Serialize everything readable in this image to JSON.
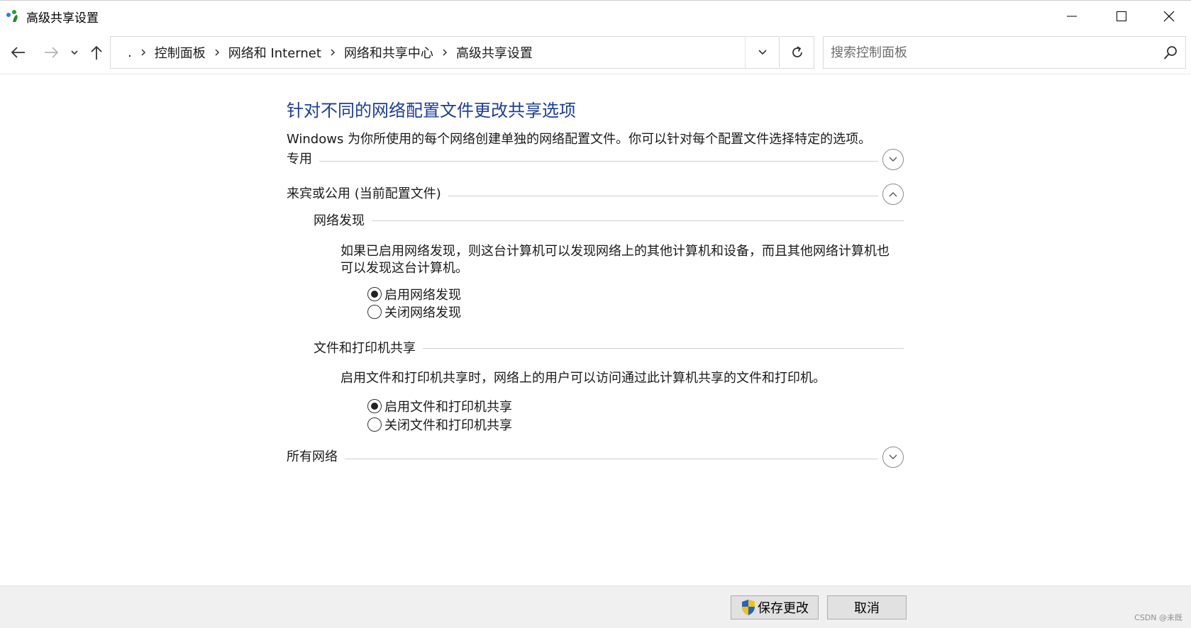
{
  "window": {
    "title": "高级共享设置"
  },
  "navigation": {
    "breadcrumb_root": ".",
    "breadcrumbs": [
      "控制面板",
      "网络和 Internet",
      "网络和共享中心",
      "高级共享设置"
    ],
    "search_placeholder": "搜索控制面板"
  },
  "main": {
    "title": "针对不同的网络配置文件更改共享选项",
    "description": "Windows 为你所使用的每个网络创建单独的网络配置文件。你可以针对每个配置文件选择特定的选项。",
    "sections": {
      "private": {
        "label": "专用",
        "expanded": false
      },
      "guest": {
        "label": "来宾或公用 (当前配置文件)",
        "expanded": true,
        "network_discovery": {
          "label": "网络发现",
          "description_line1": "如果已启用网络发现，则这台计算机可以发现网络上的其他计算机和设备，而且其他网络计算机也",
          "description_line2": "可以发现这台计算机。",
          "options": [
            "启用网络发现",
            "关闭网络发现"
          ],
          "selected": 0
        },
        "file_printer_sharing": {
          "label": "文件和打印机共享",
          "description": "启用文件和打印机共享时，网络上的用户可以访问通过此计算机共享的文件和打印机。",
          "options": [
            "启用文件和打印机共享",
            "关闭文件和打印机共享"
          ],
          "selected": 0
        }
      },
      "all_networks": {
        "label": "所有网络",
        "expanded": false
      }
    }
  },
  "footer": {
    "save_label": "保存更改",
    "cancel_label": "取消",
    "watermark": "CSDN @未既"
  },
  "colors": {
    "title_blue": "#1c3f94",
    "footer_bg": "#f0f0f0",
    "button_bg": "#e1e1e1"
  },
  "icons": [
    "network-app-icon",
    "minimize-icon",
    "maximize-icon",
    "close-icon",
    "back-arrow-icon",
    "forward-arrow-icon",
    "chevron-down-icon",
    "up-arrow-icon",
    "refresh-icon",
    "search-icon",
    "chevron-up-icon",
    "shield-icon"
  ]
}
